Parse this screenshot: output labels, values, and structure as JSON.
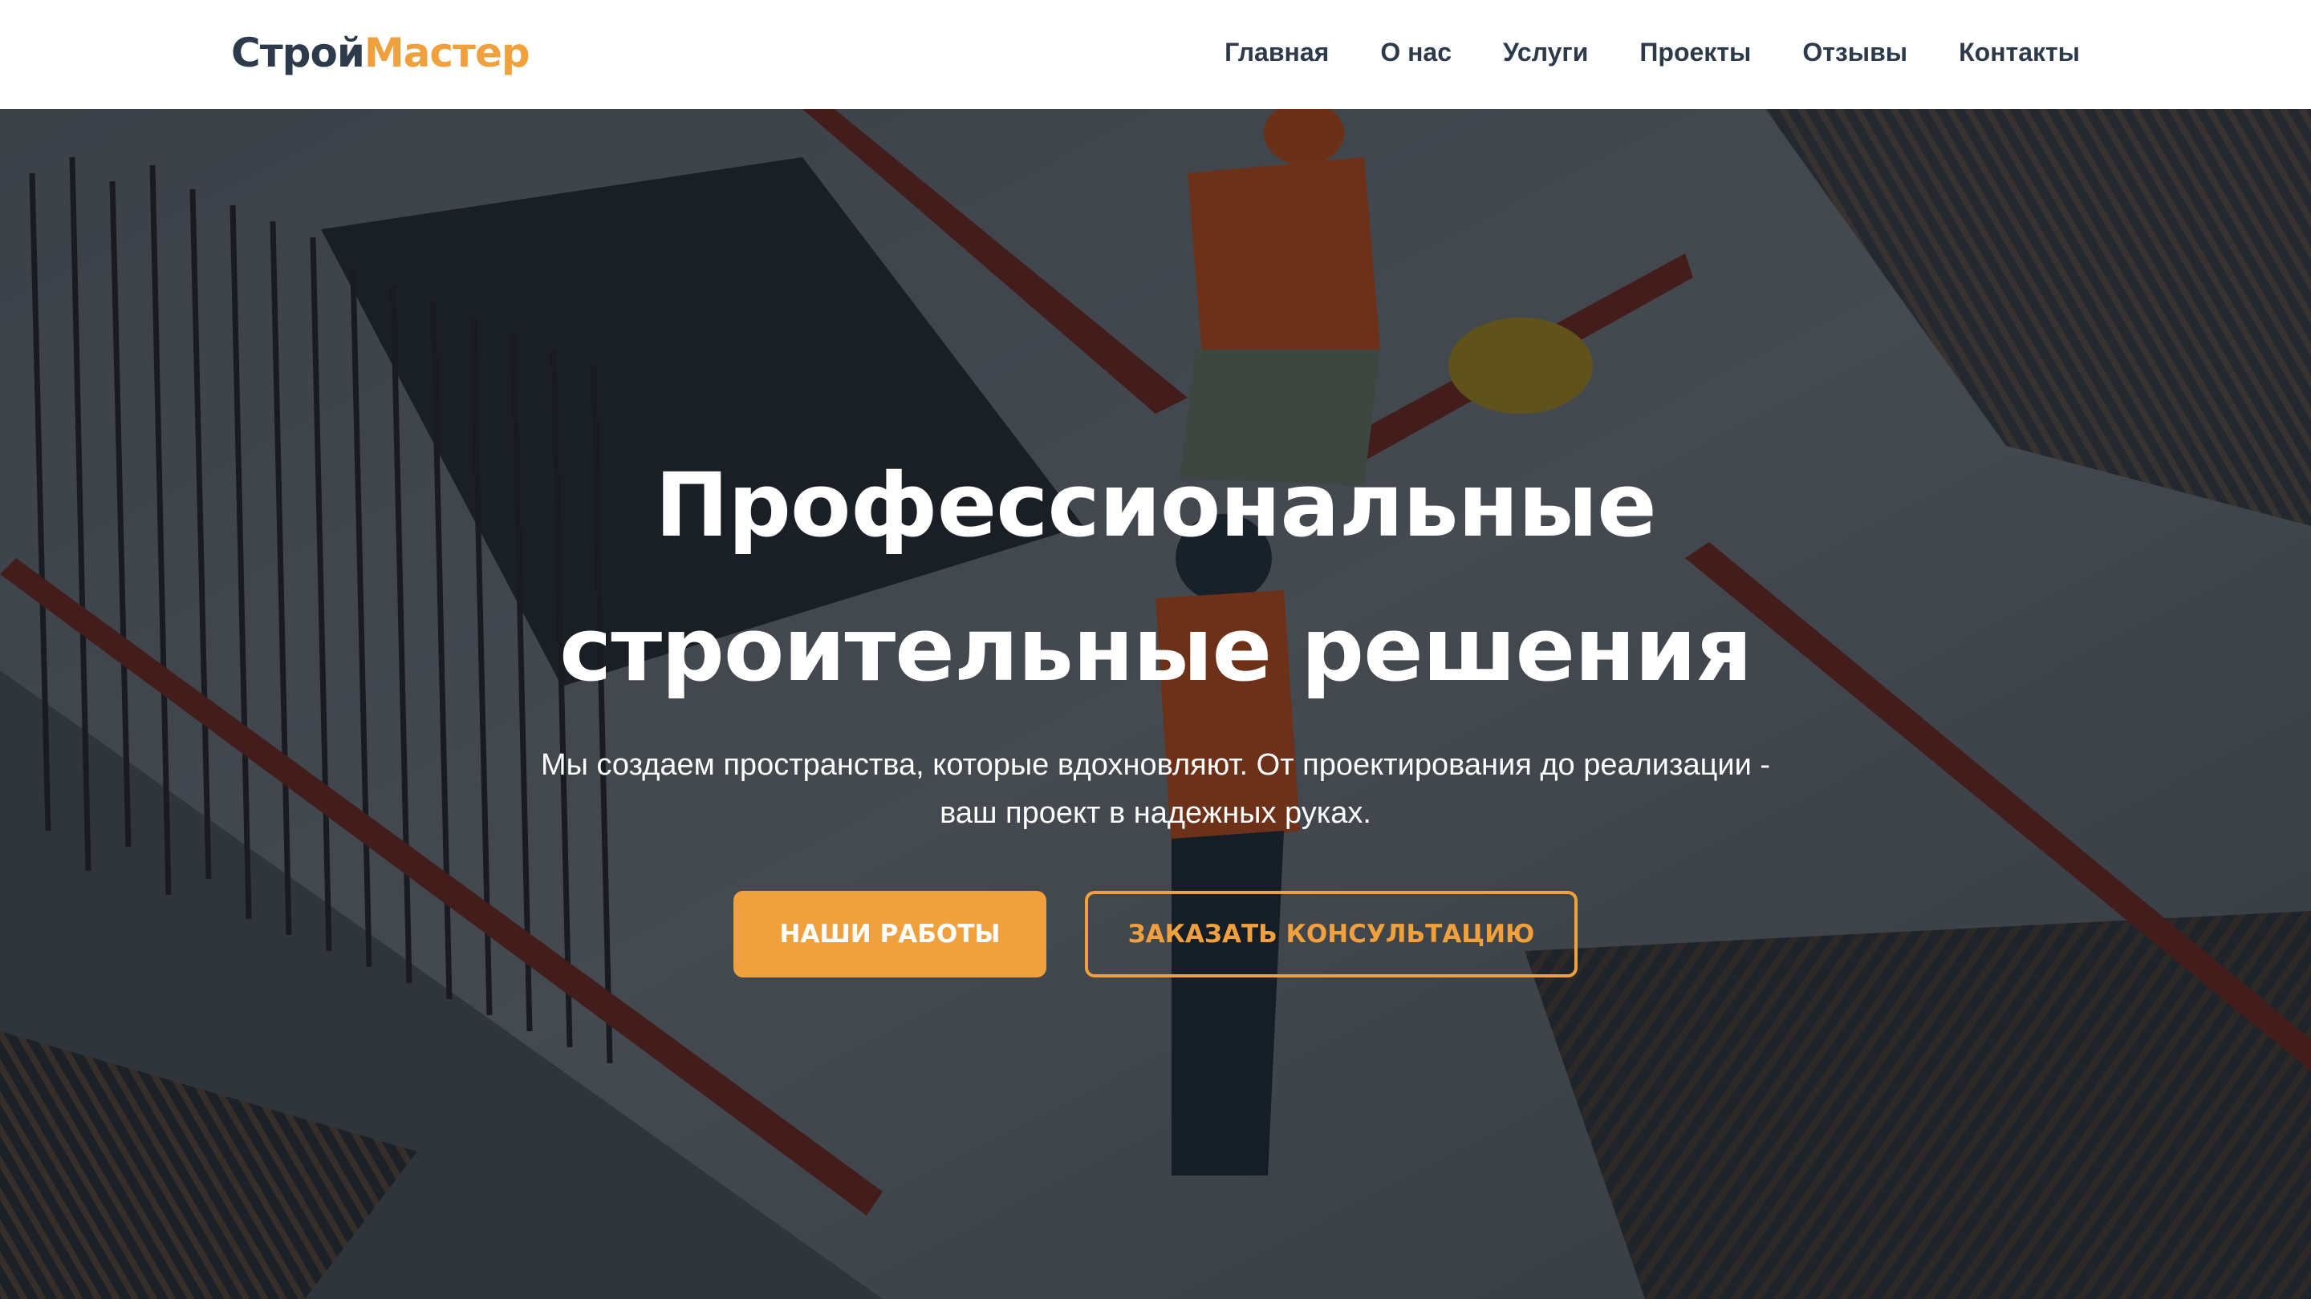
{
  "brand": {
    "part1": "Строй",
    "part2": "Мастер",
    "color_dark": "#2d3a4b",
    "color_accent": "#f0a03c"
  },
  "nav": {
    "items": [
      {
        "label": "Главная"
      },
      {
        "label": "О нас"
      },
      {
        "label": "Услуги"
      },
      {
        "label": "Проекты"
      },
      {
        "label": "Отзывы"
      },
      {
        "label": "Контакты"
      }
    ]
  },
  "hero": {
    "title_line1": "Профессиональные",
    "title_line2": "строительные решения",
    "subtitle_line1": "Мы создаем пространства, которые вдохновляют. От проектирования до реализации -",
    "subtitle_line2": "ваш проект в надежных руках.",
    "primary_button": "НАШИ РАБОТЫ",
    "secondary_button": "ЗАКАЗАТЬ КОНСУЛЬТАЦИЮ",
    "background": "construction-site-photo"
  }
}
